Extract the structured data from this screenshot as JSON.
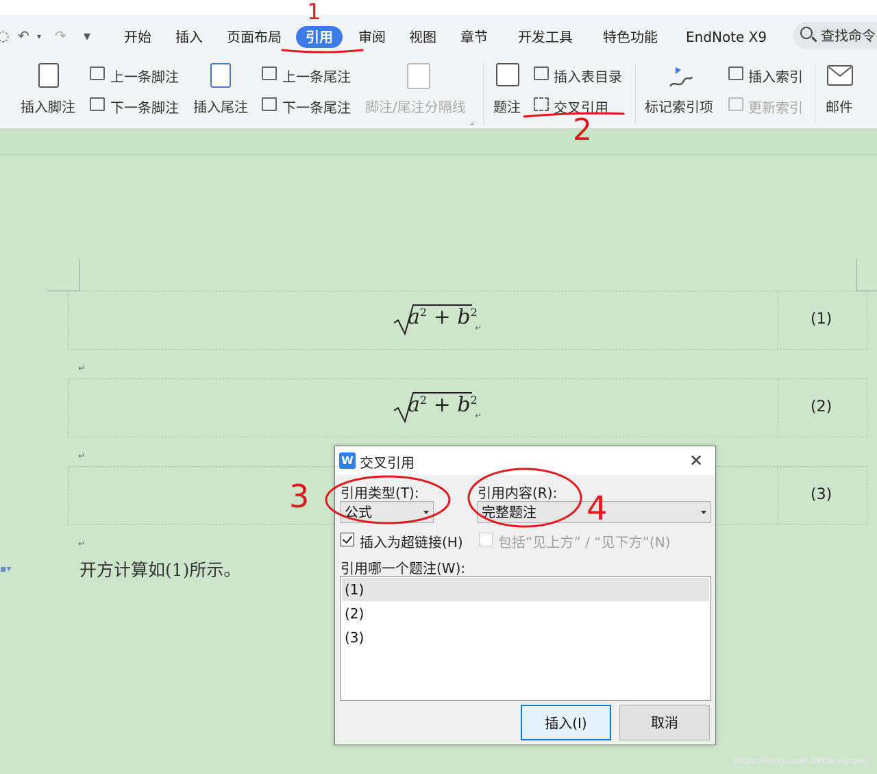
{
  "quick_access": {
    "undo": "↶",
    "redo": "↷",
    "more": "▾"
  },
  "tabs": [
    "开始",
    "插入",
    "页面布局",
    "引用",
    "审阅",
    "视图",
    "章节",
    "开发工具",
    "特色功能",
    "EndNote X9"
  ],
  "active_tab": "引用",
  "search_label": "查找命令",
  "ribbon": {
    "insert_footnote": "插入脚注",
    "prev_footnote": "上一条脚注",
    "next_footnote": "下一条脚注",
    "insert_endnote": "插入尾注",
    "prev_endnote": "上一条尾注",
    "next_endnote": "下一条尾注",
    "separator_line": "脚注/尾注分隔线",
    "caption": "题注",
    "insert_toc": "插入表目录",
    "cross_reference": "交叉引用",
    "mark_index": "标记索引项",
    "insert_index": "插入索引",
    "update_index": "更新索引",
    "mail": "邮件"
  },
  "document": {
    "formula_base": "a",
    "formula_base2": "b",
    "formula_exp": "2",
    "equations": [
      {
        "number": "(1)"
      },
      {
        "number": "(2)"
      },
      {
        "number": "(3)"
      }
    ],
    "body_text": "开方计算如(1)所示。"
  },
  "dialog": {
    "title": "交叉引用",
    "ref_type_label": "引用类型(T):",
    "ref_type_value": "公式",
    "ref_content_label": "引用内容(R):",
    "ref_content_value": "完整题注",
    "insert_hyperlink_label": "插入为超链接(H)",
    "insert_hyperlink_checked": true,
    "include_above_below_label": "包括“见上方” / “见下方”(N)",
    "which_caption_label": "引用哪一个题注(W):",
    "captions": [
      "(1)",
      "(2)",
      "(3)"
    ],
    "selected_caption": "(1)",
    "insert_button": "插入(I)",
    "cancel_button": "取消"
  },
  "annotations": {
    "n1": "1",
    "n2": "2",
    "n3": "3",
    "n4": "4"
  },
  "watermark": "https://blog.csdn.net/wasjrong"
}
